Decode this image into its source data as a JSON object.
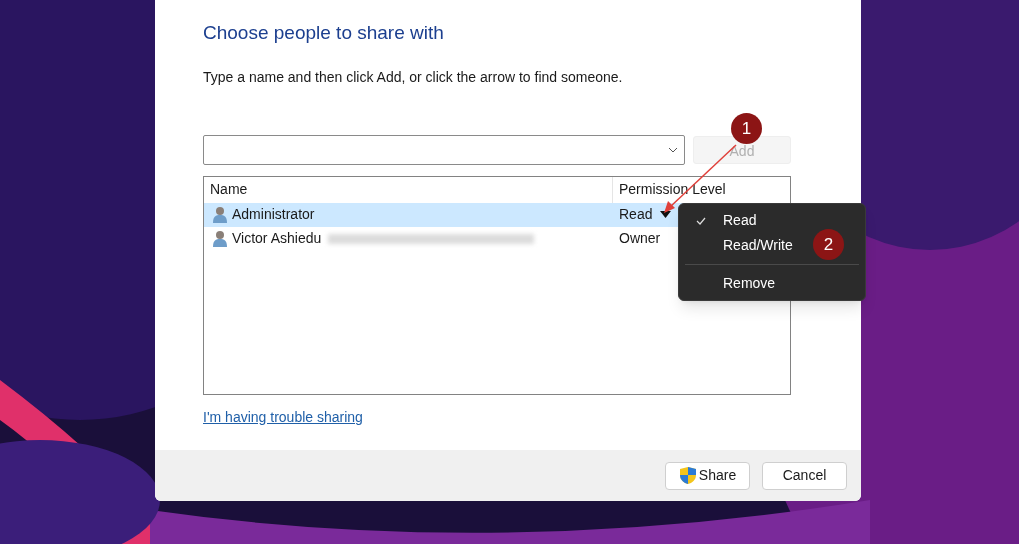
{
  "dialog": {
    "heading": "Choose people to share with",
    "instruction": "Type a name and then click Add, or click the arrow to find someone.",
    "add_button": {
      "label": "Add",
      "disabled": true
    },
    "list": {
      "columns": [
        "Name",
        "Permission Level"
      ],
      "rows": [
        {
          "name": "Administrator",
          "permission": "Read",
          "selected": true,
          "expanded": true,
          "email_blurred": false
        },
        {
          "name": "Victor Ashiedu",
          "permission": "Owner",
          "selected": false,
          "expanded": false,
          "email_blurred": true
        }
      ]
    },
    "help_link": "I'm having trouble sharing",
    "buttons": [
      {
        "label": "Share",
        "kind": "shield"
      },
      {
        "label": "Cancel",
        "kind": "plain"
      }
    ]
  },
  "permission_menu": {
    "items": [
      {
        "kind": "item",
        "label": "Read",
        "checked": true
      },
      {
        "kind": "item",
        "label": "Read/Write",
        "checked": false
      },
      {
        "kind": "separator"
      },
      {
        "kind": "item",
        "label": "Remove",
        "checked": false
      }
    ]
  },
  "annotations": [
    {
      "label": "1"
    },
    {
      "label": "2"
    }
  ]
}
